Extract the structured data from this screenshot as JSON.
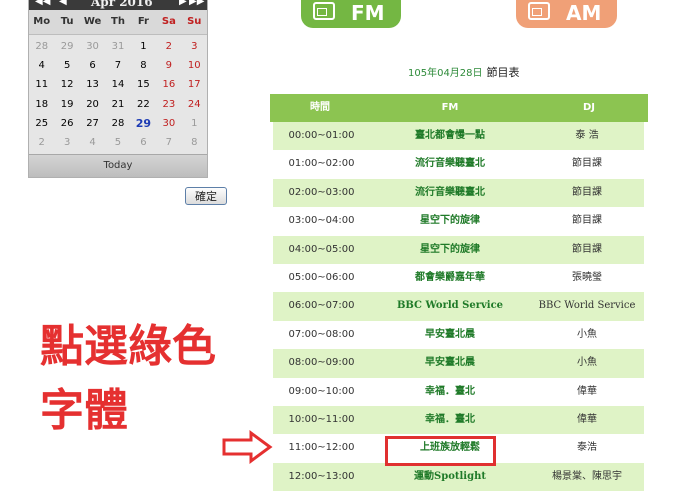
{
  "calendar": {
    "nav_prev_year": "◀◀",
    "nav_prev_month": "◀",
    "nav_next_month": "▶",
    "nav_next_year": "▶▶",
    "month_label": "Apr 2016",
    "weekdays": [
      "Mo",
      "Tu",
      "We",
      "Th",
      "Fr",
      "Sa",
      "Su"
    ],
    "weeks": [
      [
        "28",
        "29",
        "30",
        "31",
        "1",
        "2",
        "3"
      ],
      [
        "4",
        "5",
        "6",
        "7",
        "8",
        "9",
        "10"
      ],
      [
        "11",
        "12",
        "13",
        "14",
        "15",
        "16",
        "17"
      ],
      [
        "18",
        "19",
        "20",
        "21",
        "22",
        "23",
        "24"
      ],
      [
        "25",
        "26",
        "27",
        "28",
        "29",
        "30",
        "1"
      ],
      [
        "2",
        "3",
        "4",
        "5",
        "6",
        "7",
        "8"
      ]
    ],
    "today_label": "Today",
    "highlight_day": "29"
  },
  "confirm_button": "確定",
  "radio": {
    "fm_label": "FM",
    "am_label": "AM"
  },
  "schedule": {
    "date": "105年04月28日",
    "title": "節目表",
    "headers": [
      "時間",
      "FM",
      "DJ"
    ],
    "rows": [
      [
        "00:00~01:00",
        "臺北都會慢一點",
        "泰 浩"
      ],
      [
        "01:00~02:00",
        "流行音樂聽臺北",
        "節目課"
      ],
      [
        "02:00~03:00",
        "流行音樂聽臺北",
        "節目課"
      ],
      [
        "03:00~04:00",
        "星空下的旋律",
        "節目課"
      ],
      [
        "04:00~05:00",
        "星空下的旋律",
        "節目課"
      ],
      [
        "05:00~06:00",
        "都會樂爵嘉年華",
        "張曉瑩"
      ],
      [
        "06:00~07:00",
        "BBC World Service",
        "BBC World Service"
      ],
      [
        "07:00~08:00",
        "早安臺北晨",
        "小魚"
      ],
      [
        "08:00~09:00",
        "早安臺北晨",
        "小魚"
      ],
      [
        "09:00~10:00",
        "幸福．臺北",
        "偉華"
      ],
      [
        "10:00~11:00",
        "幸福．臺北",
        "偉華"
      ],
      [
        "11:00~12:00",
        "上班族放輕鬆",
        "泰浩"
      ],
      [
        "12:00~13:00",
        "運動Spotlight",
        "楊景棠、陳思宇"
      ]
    ]
  },
  "annotation": {
    "line1": "點選綠色",
    "line2": "字體"
  },
  "colors": {
    "accent_green": "#8cc451",
    "program_green": "#1f7a28",
    "annotation_red": "#e53030",
    "am_orange": "#f0a077"
  }
}
